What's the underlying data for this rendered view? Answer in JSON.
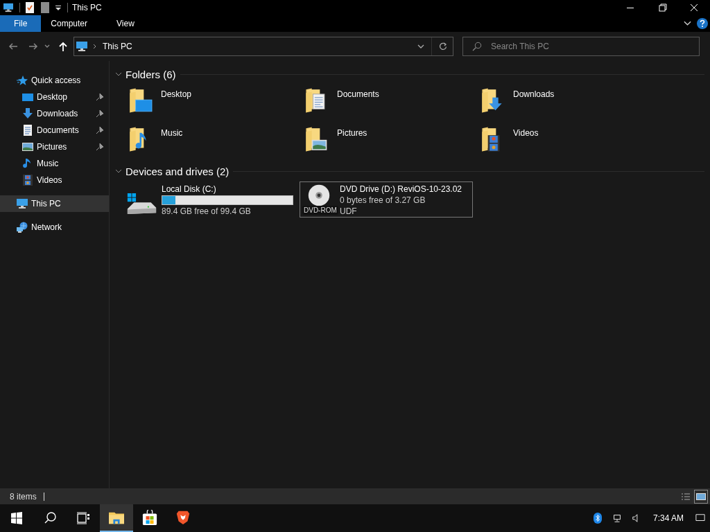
{
  "window": {
    "title": "This PC"
  },
  "ribbon_tabs": [
    {
      "label": "File",
      "selected": true
    },
    {
      "label": "Computer",
      "selected": false
    },
    {
      "label": "View",
      "selected": false
    }
  ],
  "address": {
    "path": "This PC"
  },
  "search": {
    "placeholder": "Search This PC"
  },
  "sidebar": {
    "items": [
      {
        "label": "Quick access",
        "kind": "star",
        "selected": false,
        "children": [
          {
            "label": "Desktop",
            "kind": "desktop",
            "pinned": true
          },
          {
            "label": "Downloads",
            "kind": "downloads",
            "pinned": true
          },
          {
            "label": "Documents",
            "kind": "documents",
            "pinned": true
          },
          {
            "label": "Pictures",
            "kind": "pictures",
            "pinned": true
          },
          {
            "label": "Music",
            "kind": "music",
            "pinned": false
          },
          {
            "label": "Videos",
            "kind": "videos",
            "pinned": false
          }
        ]
      },
      {
        "label": "This PC",
        "kind": "pc",
        "selected": true
      },
      {
        "label": "Network",
        "kind": "network",
        "selected": false
      }
    ]
  },
  "folders": {
    "title": "Folders (6)",
    "expanded": true,
    "items": [
      {
        "name": "Desktop",
        "kind": "desktop"
      },
      {
        "name": "Documents",
        "kind": "documents"
      },
      {
        "name": "Downloads",
        "kind": "downloads"
      },
      {
        "name": "Music",
        "kind": "music"
      },
      {
        "name": "Pictures",
        "kind": "pictures"
      },
      {
        "name": "Videos",
        "kind": "videos"
      }
    ]
  },
  "drives": {
    "title": "Devices and drives (2)",
    "expanded": true,
    "items": [
      {
        "name": "Local Disk (C:)",
        "kind": "disk",
        "level": 0.1,
        "free": "89.4 GB free of 99.4 GB",
        "selected": false
      },
      {
        "name": "DVD Drive (D:) ReviOS-10-23.02",
        "kind": "dvd",
        "badge": "DVD-ROM",
        "free": "0 bytes free of 3.27 GB",
        "filesystem": "UDF",
        "selected": true
      }
    ]
  },
  "status_bar": {
    "count": "8 items",
    "view_buttons": [
      {
        "kind": "details",
        "selected": false
      },
      {
        "kind": "large-icons",
        "selected": true
      }
    ]
  },
  "taskbar": {
    "apps": [
      {
        "kind": "explorer",
        "active": true
      },
      {
        "kind": "store",
        "active": false
      },
      {
        "kind": "browser",
        "active": false
      }
    ],
    "clock": "7:34 AM"
  }
}
